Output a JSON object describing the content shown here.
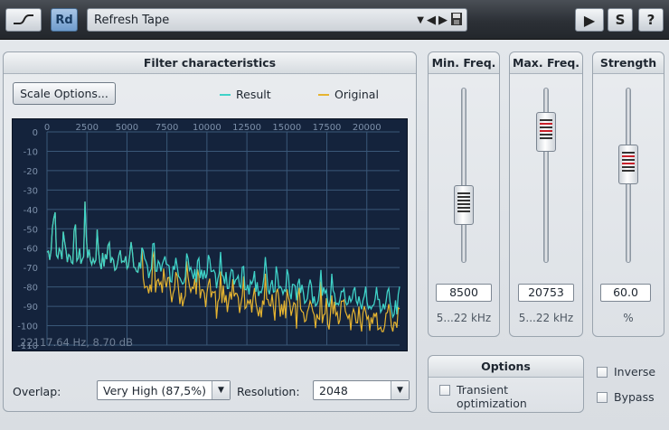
{
  "toolbar": {
    "curve_icon": "curve-icon",
    "rd_label": "Rd",
    "preset_name": "Refresh Tape",
    "play_label": "▶",
    "s_label": "S",
    "help_label": "?"
  },
  "filter_panel": {
    "title": "Filter characteristics",
    "scale_button": "Scale Options...",
    "legend": [
      {
        "name": "Result",
        "color": "#3fd2c8"
      },
      {
        "name": "Original",
        "color": "#e6b430"
      }
    ],
    "status": "22117.64 Hz, 8.70 dB",
    "overlap_label": "Overlap:",
    "overlap_value": "Very High (87,5%)",
    "resolution_label": "Resolution:",
    "resolution_value": "2048"
  },
  "chart_data": {
    "type": "line",
    "x_ticks": [
      "0",
      "2500",
      "5000",
      "7500",
      "10000",
      "12500",
      "15000",
      "17500",
      "20000"
    ],
    "y_ticks": [
      "0",
      "-10",
      "-20",
      "-30",
      "-40",
      "-50",
      "-60",
      "-70",
      "-80",
      "-90",
      "-100",
      "-110"
    ],
    "xlim": [
      0,
      22050
    ],
    "ylim": [
      -110,
      0
    ],
    "grid": true,
    "series": [
      {
        "name": "Result",
        "color": "#3fd2c8"
      },
      {
        "name": "Original",
        "color": "#e6b430"
      }
    ]
  },
  "sliders": [
    {
      "title": "Min. Freq.",
      "value": "8500",
      "unit": "5...22 kHz",
      "level": 0.72
    },
    {
      "title": "Max. Freq.",
      "value": "20753",
      "unit": "5...22 kHz",
      "level": 0.18
    },
    {
      "title": "Strength",
      "value": "60.0",
      "unit": "%",
      "level": 0.42
    }
  ],
  "options": {
    "title": "Options",
    "transient_line1": "Transient",
    "transient_line2": "optimization",
    "inverse": "Inverse",
    "bypass": "Bypass"
  }
}
